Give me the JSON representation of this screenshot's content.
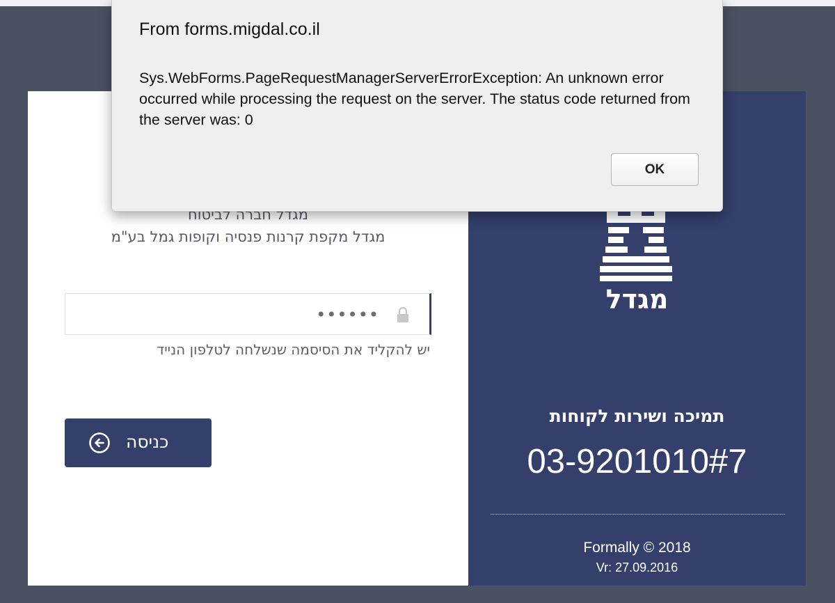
{
  "dialog": {
    "title": "From forms.migdal.co.il",
    "message": "Sys.WebForms.PageRequestManagerServerErrorException: An unknown error occurred while processing the request on the server. The status code returned from the server was: 0",
    "ok_label": "OK"
  },
  "form": {
    "company_line_1": "מגדל חברה לביטוח",
    "company_line_2": "מגדל מקפת קרנות פנסיה וקופות גמל בע\"מ",
    "password_value": "••••••",
    "password_icon": "lock-icon",
    "hint": "יש להקליד את הסיסמה שנשלחה לטלפון הנייד",
    "login_label": "כניסה",
    "login_icon": "arrow-left-circle-icon"
  },
  "brand": {
    "logo_text": "מגדל",
    "support_title": "תמיכה ושירות לקוחות",
    "support_phone": "03-9201010#7",
    "copyright": "Formally © 2018",
    "version": "Vr: 27.09.2016"
  },
  "colors": {
    "background": "#4a5161",
    "brand_blue": "#343f6c",
    "dialog_bg": "#efefef"
  }
}
